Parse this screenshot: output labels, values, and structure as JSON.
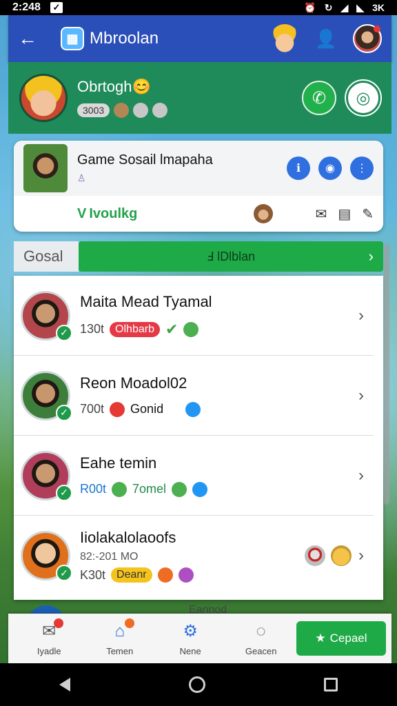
{
  "status_bar": {
    "time": "2:248",
    "signal_text": "3K"
  },
  "header": {
    "title": "Mbroolan",
    "logo_glyph": "▦"
  },
  "profile": {
    "name": "Obrtogh😊",
    "stat": "3003"
  },
  "game_card": {
    "title": "Game Sosail lmapaha",
    "subtitle": "♙",
    "tag": "Ivoulkg",
    "tag_check": "V"
  },
  "section": {
    "label": "Gosal",
    "button_label": "Ⅎ lDlblan"
  },
  "friends": [
    {
      "name": "Maita Mead Tyamal",
      "score": "130t",
      "status": "Olhbarb",
      "status_style": "red",
      "extra": ""
    },
    {
      "name": "Reon Moadol02",
      "score": "700t",
      "status": "",
      "extra": "Gonid"
    },
    {
      "name": "Eahe temin",
      "score": "R00t",
      "status": "",
      "extra": "7omel"
    },
    {
      "name": "Iiolakalolaoofs",
      "sub": "82:-201 MO",
      "score": "K30t",
      "status": "Deanr",
      "status_style": "gold",
      "extra": ""
    }
  ],
  "peek_text": "Eannod",
  "bottom_nav": {
    "items": [
      {
        "label": "Iyadle",
        "icon": "✉"
      },
      {
        "label": "Temen",
        "icon": "⌂"
      },
      {
        "label": "Nene",
        "icon": "⚙"
      },
      {
        "label": "Geacen",
        "icon": "◌"
      }
    ],
    "cta_label": "Cepael",
    "cta_icon": "★"
  },
  "colors": {
    "header_blue": "#2b4fb8",
    "profile_green": "#1f8a5a",
    "accent_green": "#1faa48",
    "action_blue": "#2f6fe0",
    "status_red": "#e53946"
  }
}
